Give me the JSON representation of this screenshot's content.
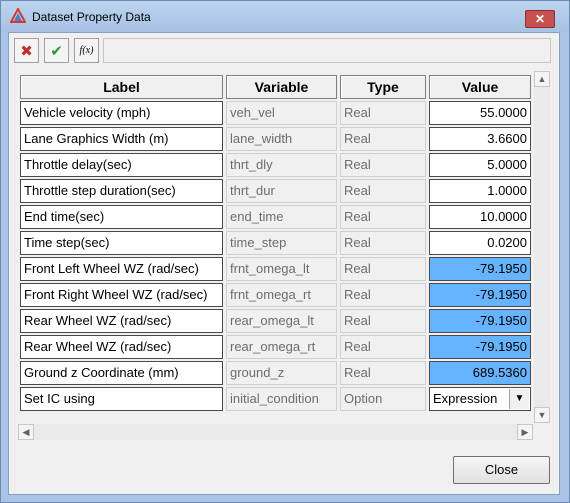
{
  "window": {
    "title": "Dataset Property Data",
    "close_glyph": "✕"
  },
  "toolbar": {
    "reject_icon": "✖",
    "accept_icon": "✔",
    "expression_icon": "f(x)"
  },
  "table": {
    "headers": [
      "Label",
      "Variable",
      "Type",
      "Value"
    ],
    "rows": [
      {
        "label": "Vehicle velocity (mph)",
        "variable": "veh_vel",
        "type": "Real",
        "value": "55.0000",
        "highlight": false
      },
      {
        "label": "Lane Graphics Width (m)",
        "variable": "lane_width",
        "type": "Real",
        "value": "3.6600",
        "highlight": false
      },
      {
        "label": "Throttle delay(sec)",
        "variable": "thrt_dly",
        "type": "Real",
        "value": "5.0000",
        "highlight": false
      },
      {
        "label": "Throttle step duration(sec)",
        "variable": "thrt_dur",
        "type": "Real",
        "value": "1.0000",
        "highlight": false
      },
      {
        "label": "End time(sec)",
        "variable": "end_time",
        "type": "Real",
        "value": "10.0000",
        "highlight": false
      },
      {
        "label": "Time step(sec)",
        "variable": "time_step",
        "type": "Real",
        "value": "0.0200",
        "highlight": false
      },
      {
        "label": "Front Left Wheel WZ (rad/sec)",
        "variable": "frnt_omega_lt",
        "type": "Real",
        "value": "-79.1950",
        "highlight": true
      },
      {
        "label": "Front Right Wheel WZ (rad/sec)",
        "variable": "frnt_omega_rt",
        "type": "Real",
        "value": "-79.1950",
        "highlight": true
      },
      {
        "label": "Rear Wheel WZ (rad/sec)",
        "variable": "rear_omega_lt",
        "type": "Real",
        "value": "-79.1950",
        "highlight": true
      },
      {
        "label": "Rear Wheel WZ (rad/sec)",
        "variable": "rear_omega_rt",
        "type": "Real",
        "value": "-79.1950",
        "highlight": true
      },
      {
        "label": "Ground z Coordinate (mm)",
        "variable": "ground_z",
        "type": "Real",
        "value": "689.5360",
        "highlight": true
      },
      {
        "label": "Set IC using",
        "variable": "initial_condition",
        "type": "Option",
        "value": "Expression",
        "highlight": false,
        "dropdown": true
      }
    ]
  },
  "scroll_arrows": {
    "up": "▲",
    "down": "▼",
    "left": "◀",
    "right": "▶"
  },
  "colors": {
    "highlight": "#66b3ff",
    "title_bar": "#a8c2e4"
  },
  "buttons": {
    "close": "Close"
  }
}
